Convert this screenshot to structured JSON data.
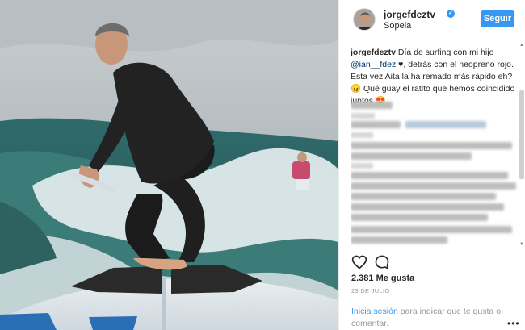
{
  "post": {
    "username": "jorgefdeztv",
    "location": "Sopela",
    "follow_label": "Seguir",
    "caption": {
      "user": "jorgefdeztv",
      "text_1": " Día de surfing con mi hijo ",
      "mention": "@ian__fdez",
      "text_2": " ♥, detrás con el neopreno rojo. Esta vez Aita la ha remado más rápido eh? 😠 Qué guay el ratito que hemos coincidido juntos 😍"
    },
    "likes": "2.381 Me gusta",
    "date": "23 DE JULIO"
  },
  "footer": {
    "login_link": "Inicia sesión",
    "login_rest": " para indicar que te gusta o comentar.",
    "more": "•••"
  },
  "icons": {
    "verified": "verified-badge-icon",
    "heart": "heart-icon",
    "comment": "comment-icon",
    "more": "more-options-icon"
  },
  "colors": {
    "accent": "#3897f0",
    "text": "#262626",
    "muted": "#999999",
    "mention": "#003569"
  }
}
